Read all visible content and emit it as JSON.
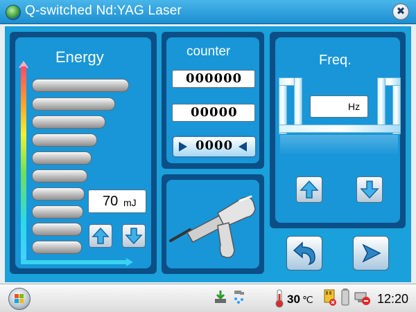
{
  "window": {
    "title": "Q-switched Nd:YAG Laser",
    "close_symbol": "✖"
  },
  "energy": {
    "heading": "Energy",
    "value": "70",
    "unit": "mJ",
    "level_bars": 10
  },
  "counter": {
    "heading": "counter",
    "total": "000000",
    "session": "00000",
    "shots": "0000"
  },
  "frequency": {
    "heading": "Freq.",
    "value": "",
    "unit": "Hz"
  },
  "taskbar": {
    "temperature_value": "30",
    "temperature_unit": "℃",
    "clock": "12:20"
  },
  "colors": {
    "frame": "#1aa0da",
    "panel_border": "#0b4f86",
    "accent_arrow": "#3fb0e8"
  }
}
